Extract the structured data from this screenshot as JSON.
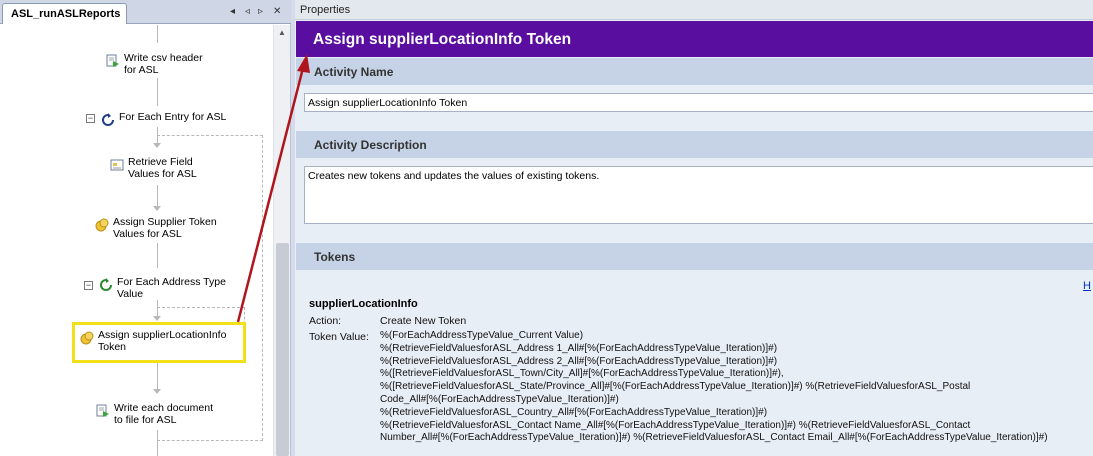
{
  "workflow_tab": {
    "title": "ASL_runASLReports",
    "controls": [
      "◂",
      "◃",
      "▹",
      "✕"
    ]
  },
  "workflow_nodes": {
    "write_header": [
      "Write csv header",
      "for ASL"
    ],
    "for_each_entry": "For Each Entry for ASL",
    "retrieve_values": [
      "Retrieve Field",
      "Values for ASL"
    ],
    "assign_supplier": [
      "Assign Supplier Token",
      "Values for ASL"
    ],
    "for_each_address": [
      "For Each Address Type",
      "Value"
    ],
    "assign_location": [
      "Assign supplierLocationInfo",
      "Token"
    ],
    "write_each": [
      "Write each document",
      "to file for ASL"
    ]
  },
  "properties": {
    "header": "Properties",
    "title": "Assign supplierLocationInfo Token",
    "activity_name_label": "Activity Name",
    "activity_name_value": "Assign supplierLocationInfo Token",
    "activity_description_label": "Activity Description",
    "activity_description_value": "Creates new tokens and updates the values of existing tokens.",
    "tokens_label": "Tokens",
    "help_link": "H",
    "token": {
      "name": "supplierLocationInfo",
      "action_label": "Action:",
      "action_value": "Create New Token",
      "value_label": "Token Value:",
      "value_lines": [
        "%(ForEachAddressTypeValue_Current Value)",
        "%(RetrieveFieldValuesforASL_Address 1_All#[%(ForEachAddressTypeValue_Iteration)]#)",
        "%(RetrieveFieldValuesforASL_Address 2_All#[%(ForEachAddressTypeValue_Iteration)]#)",
        "%([RetrieveFieldValuesforASL_Town/City_All]#[%(ForEachAddressTypeValue_Iteration)]#),",
        "%([RetrieveFieldValuesforASL_State/Province_All]#[%(ForEachAddressTypeValue_Iteration)]#) %(RetrieveFieldValuesforASL_Postal",
        "Code_All#[%(ForEachAddressTypeValue_Iteration)]#)",
        "%(RetrieveFieldValuesforASL_Country_All#[%(ForEachAddressTypeValue_Iteration)]#)",
        "%(RetrieveFieldValuesforASL_Contact Name_All#[%(ForEachAddressTypeValue_Iteration)]#) %(RetrieveFieldValuesforASL_Contact",
        "Number_All#[%(ForEachAddressTypeValue_Iteration)]#) %(RetrieveFieldValuesforASL_Contact Email_All#[%(ForEachAddressTypeValue_Iteration)]#)"
      ]
    }
  },
  "colors": {
    "title_bar": "#5a0ea0",
    "section_header": "#c6d3e7",
    "highlight": "#f2e01a",
    "annotation_arrow": "#b0141c"
  }
}
